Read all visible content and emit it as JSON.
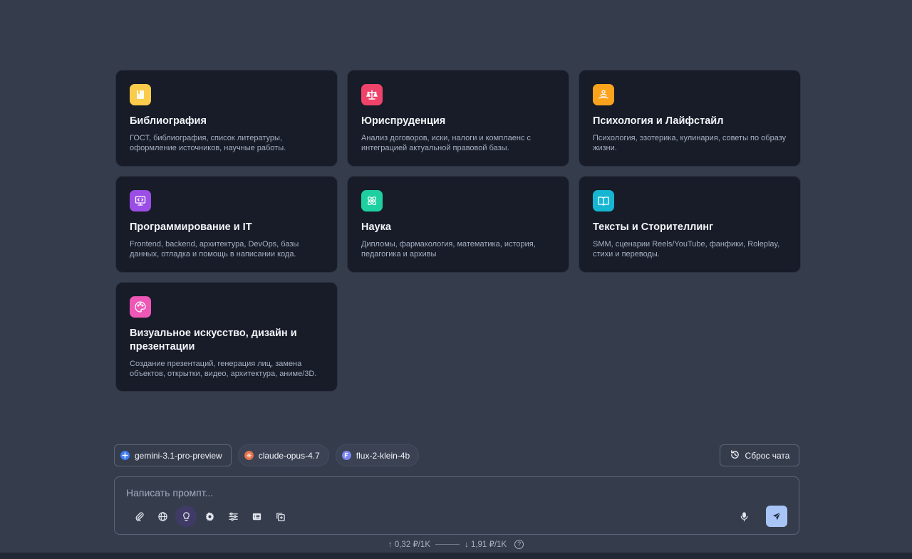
{
  "cards": [
    {
      "title": "Библиография",
      "desc": "ГОСТ, библиография, список литературы, оформление источников, научные работы.",
      "icon": "book-icon",
      "color": "#fbcb4b"
    },
    {
      "title": "Юриспруденция",
      "desc": "Анализ договоров, иски, налоги и комплаенс с интеграцией актуальной правовой базы.",
      "icon": "scales-icon",
      "color": "#f0436a"
    },
    {
      "title": "Психология и Лайфстайл",
      "desc": "Психология, эзотерика, кулинария, советы по образу жизни.",
      "icon": "meditation-icon",
      "color": "#fba31c"
    },
    {
      "title": "Программирование и IT",
      "desc": "Frontend, backend, архитектура, DevOps, базы данных, отладка и помощь в написании кода.",
      "icon": "code-monitor-icon",
      "color": "#9b4ee6"
    },
    {
      "title": "Наука",
      "desc": "Дипломы, фармакология, математика, история, педагогика и архивы",
      "icon": "atom-icon",
      "color": "#1ed0a0"
    },
    {
      "title": "Тексты и Сторителлинг",
      "desc": "SMM, сценарии Reels/YouTube, фанфики, Roleplay, стихи и переводы.",
      "icon": "book-open-icon",
      "color": "#16b6d3"
    },
    {
      "title": "Визуальное искусство, дизайн и презентации",
      "desc": "Создание презентаций, генерация лиц, замена объектов, открытки, видео, архитектура, аниме/3D.",
      "icon": "palette-icon",
      "color": "#ee57b6"
    }
  ],
  "models": [
    {
      "label": "gemini-3.1-pro-preview",
      "icon": "gemini-icon",
      "color": "#3f7cf2"
    },
    {
      "label": "claude-opus-4.7",
      "icon": "claude-icon",
      "color": "#e0704c"
    },
    {
      "label": "flux-2-klein-4b",
      "icon": "flux-icon",
      "color": "#7b86f0"
    }
  ],
  "reset_label": "Сброс чата",
  "composer": {
    "placeholder": "Написать промпт...",
    "value": ""
  },
  "tools": [
    "paperclip-icon",
    "globe-icon",
    "lightbulb-icon",
    "gear-icon",
    "sliders-icon",
    "list-icon",
    "add-copy-icon"
  ],
  "pricing": {
    "input": "↑ 0,32 ₽/1K",
    "output": "↓ 1,91 ₽/1K",
    "help": "?"
  },
  "colors": {
    "background": "#353d4d",
    "card": "#171c28",
    "send_button": "#a9c5f7",
    "active_tool": "#3f3a66"
  }
}
